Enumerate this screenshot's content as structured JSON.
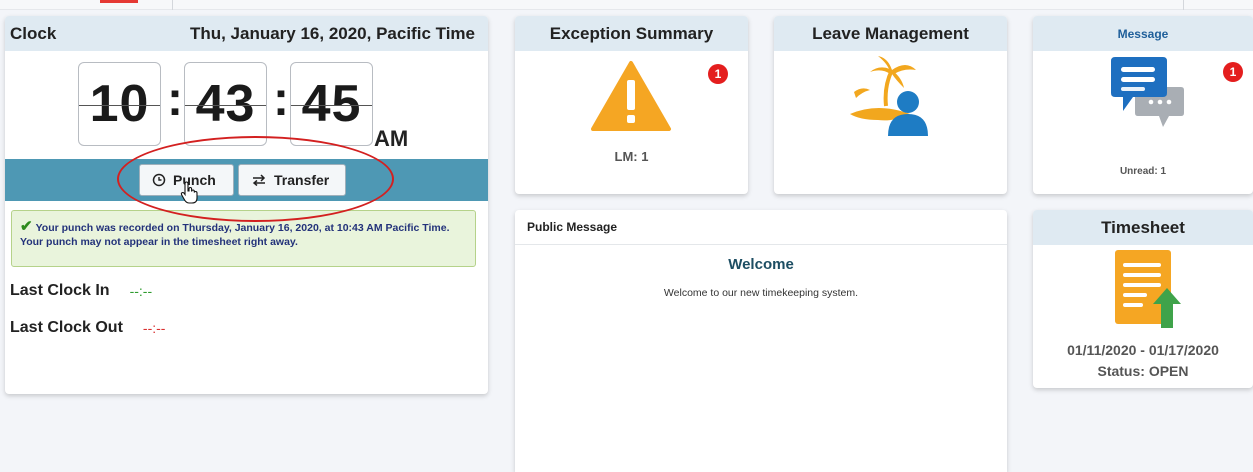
{
  "colors": {
    "punch_bar": "#4e98b4",
    "card_header": "#dfeaf2",
    "badge": "#e41e1e",
    "notice_bg": "#e9f4dc",
    "last_in_value": "#2e9b2e",
    "last_out_value": "#d93030",
    "warning_icon": "#f5a623",
    "message_icon": "#1e6fc0"
  },
  "clock": {
    "title": "Clock",
    "date": "Thu, January 16, 2020, Pacific Time",
    "hours": "10",
    "minutes": "43",
    "seconds": "45",
    "separator": ":",
    "ampm": "AM",
    "punch_label": "Punch",
    "transfer_label": "Transfer",
    "notice": "Your punch was recorded on Thursday, January 16, 2020, at 10:43 AM Pacific Time. Your punch may not appear in the timesheet right away.",
    "last_in_label": "Last Clock In",
    "last_in_value": "--:--",
    "last_out_label": "Last Clock Out",
    "last_out_value": "--:--"
  },
  "exception": {
    "title": "Exception Summary",
    "badge": "1",
    "label": "LM: 1",
    "icon": "warning-triangle-icon"
  },
  "leave": {
    "title": "Leave Management",
    "icon": "island-person-icon"
  },
  "message": {
    "title": "Message",
    "badge": "1",
    "label": "Unread:  1",
    "icon": "chat-bubbles-icon"
  },
  "public_message": {
    "title": "Public Message",
    "heading": "Welcome",
    "body": "Welcome to our new timekeeping system."
  },
  "timesheet": {
    "title": "Timesheet",
    "range": "01/11/2020 - 01/17/2020",
    "status": "Status: OPEN",
    "icon": "timesheet-upload-icon"
  }
}
